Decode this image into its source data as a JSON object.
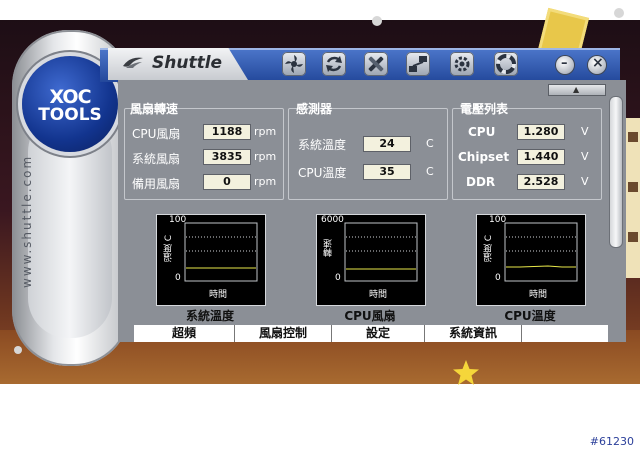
{
  "brand": {
    "logo_line1": "XOC",
    "logo_line2": "TOOLS",
    "name": "Shuttle",
    "url": "www.shuttle.com"
  },
  "toolbar": {
    "icons": [
      "fan-icon",
      "refresh-icon",
      "tools-icon",
      "network-icon",
      "settings-icon",
      "lifebuoy-icon"
    ],
    "minimize": "–",
    "close": "×"
  },
  "scroll_up": "▲",
  "fan": {
    "title": "風扇轉速",
    "rows": [
      {
        "label": "CPU風扇",
        "value": "1188",
        "unit": "rpm"
      },
      {
        "label": "系統風扇",
        "value": "3835",
        "unit": "rpm"
      },
      {
        "label": "備用風扇",
        "value": "0",
        "unit": "rpm"
      }
    ]
  },
  "sensor": {
    "title": "感測器",
    "rows": [
      {
        "label": "系統溫度",
        "value": "24",
        "unit": "C"
      },
      {
        "label": "CPU溫度",
        "value": "35",
        "unit": "C"
      }
    ]
  },
  "voltage": {
    "title": "電壓列表",
    "rows": [
      {
        "label": "CPU",
        "value": "1.280",
        "unit": "V"
      },
      {
        "label": "Chipset",
        "value": "1.440",
        "unit": "V"
      },
      {
        "label": "DDR",
        "value": "2.528",
        "unit": "V"
      }
    ]
  },
  "charts": [
    {
      "caption": "系統溫度",
      "y_label": "溫度 C",
      "x_label": "時間",
      "y_max": "100",
      "y_min": "0",
      "line_color": "#e8e84a"
    },
    {
      "caption": "CPU風扇",
      "y_label": "轉速",
      "x_label": "時間",
      "y_max": "6000",
      "y_min": "0",
      "line_color": "#e8e84a"
    },
    {
      "caption": "CPU溫度",
      "y_label": "溫度 C",
      "x_label": "時間",
      "y_max": "100",
      "y_min": "0",
      "line_color": "#e8e84a"
    }
  ],
  "tabs": [
    "超頻",
    "風扇控制",
    "設定",
    "系統資訊"
  ],
  "watermark": "#61230",
  "colors": {
    "title_bar": "#23489b",
    "panel": "#8b8f96",
    "value_box": "#f3f1de",
    "star": "#f5d63a"
  }
}
